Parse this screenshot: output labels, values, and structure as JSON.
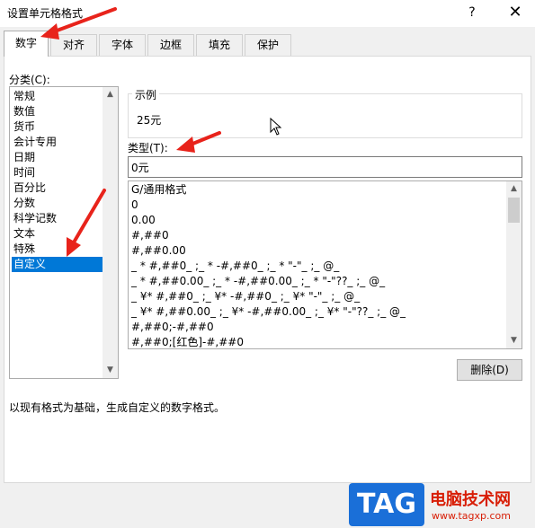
{
  "window": {
    "title": "设置单元格格式",
    "help_glyph": "?",
    "close_glyph": "✕"
  },
  "tabs": [
    {
      "label": "数字",
      "active": true
    },
    {
      "label": "对齐"
    },
    {
      "label": "字体"
    },
    {
      "label": "边框"
    },
    {
      "label": "填充"
    },
    {
      "label": "保护"
    }
  ],
  "category": {
    "label": "分类(C):",
    "items": [
      "常规",
      "数值",
      "货币",
      "会计专用",
      "日期",
      "时间",
      "百分比",
      "分数",
      "科学记数",
      "文本",
      "特殊",
      "自定义"
    ],
    "selected": "自定义"
  },
  "sample": {
    "label": "示例",
    "value": "25元"
  },
  "type": {
    "label": "类型(T):",
    "value": "0元"
  },
  "formats": [
    "G/通用格式",
    "0",
    "0.00",
    "#,##0",
    "#,##0.00",
    "_ * #,##0_ ;_ * -#,##0_ ;_ * \"-\"_ ;_ @_",
    "_ * #,##0.00_ ;_ * -#,##0.00_ ;_ * \"-\"??_ ;_ @_",
    "_ ¥* #,##0_ ;_ ¥* -#,##0_ ;_ ¥* \"-\"_ ;_ @_",
    "_ ¥* #,##0.00_ ;_ ¥* -#,##0.00_ ;_ ¥* \"-\"??_ ;_ @_",
    "#,##0;-#,##0",
    "#,##0;[红色]-#,##0"
  ],
  "delete_button": "删除(D)",
  "description": "以现有格式为基础，生成自定义的数字格式。",
  "watermark": {
    "logo": "TAG",
    "name": "电脑技术网",
    "url": "www.tagxp.com"
  },
  "colors": {
    "selection": "#0078d7",
    "arrow": "#e8231b",
    "watermark_blue": "#1a6fd8",
    "watermark_red": "#d81e06"
  },
  "icons": {
    "help": "help-icon",
    "close": "close-icon",
    "scroll_up": "scroll-up-arrow-icon",
    "scroll_down": "scroll-down-arrow-icon",
    "cursor": "mouse-cursor-icon",
    "annotation": "red-arrow-icon"
  }
}
